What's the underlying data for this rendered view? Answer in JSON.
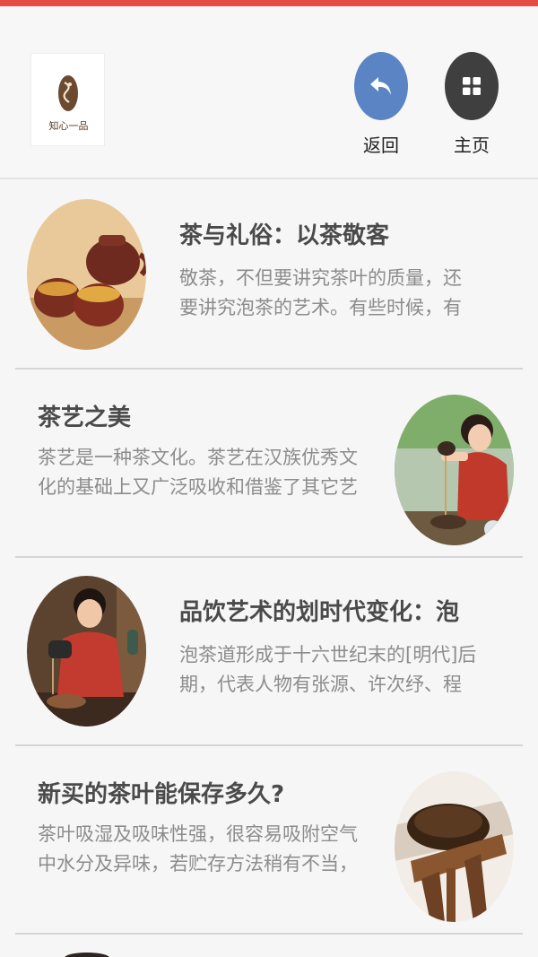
{
  "header": {
    "logo_text": "知心一品",
    "back_label": "返回",
    "home_label": "主页",
    "colors": {
      "top_bar": "#e64a45",
      "back_button": "#5b84c4",
      "home_button": "#3f3f3f"
    }
  },
  "articles": [
    {
      "title": "茶与礼俗：以茶敬客",
      "description": "敬茶，不但要讲究茶叶的质量，还要讲究泡茶的艺术。有些时候，有",
      "image": "tea-cups-teapot"
    },
    {
      "title": "茶艺之美",
      "description": "茶艺是一种茶文化。茶艺在汉族优秀文化的基础上又广泛吸收和借鉴了其它艺",
      "image": "tea-pouring-woman"
    },
    {
      "title": "品饮艺术的划时代变化：泡",
      "description": "泡茶道形成于十六世纪末的[明代]后期，代表人物有张源、许次纾、程",
      "image": "tea-ceremony-girl"
    },
    {
      "title": "新买的茶叶能保存多久?",
      "description": "茶叶吸湿及吸味性强，很容易吸附空气中水分及异味，若贮存方法稍有不当，",
      "image": "dried-tea-leaves"
    }
  ]
}
